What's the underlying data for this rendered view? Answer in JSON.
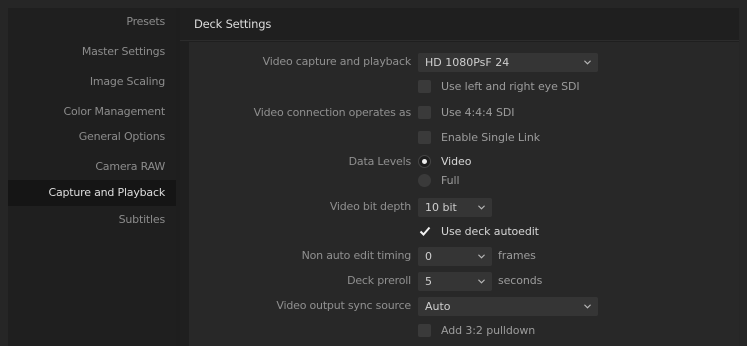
{
  "sidebar": {
    "items": [
      {
        "label": "Presets"
      },
      {
        "label": "Master Settings"
      },
      {
        "label": "Image Scaling"
      },
      {
        "label": "Color Management"
      },
      {
        "label": "General Options"
      },
      {
        "label": "Camera RAW"
      },
      {
        "label": "Capture and Playback",
        "active": true
      },
      {
        "label": "Subtitles"
      }
    ]
  },
  "section": {
    "title": "Deck Settings"
  },
  "form": {
    "video_capture": {
      "label": "Video capture and playback",
      "value": "HD 1080PsF 24"
    },
    "left_right_sdi": {
      "label": "Use left and right eye SDI",
      "checked": false
    },
    "video_connection": {
      "label": "Video connection operates as"
    },
    "use_444": {
      "label": "Use 4:4:4 SDI",
      "checked": false
    },
    "single_link": {
      "label": "Enable Single Link",
      "checked": false
    },
    "data_levels": {
      "label": "Data Levels",
      "options": [
        "Video",
        "Full"
      ],
      "selected": "Video"
    },
    "bit_depth": {
      "label": "Video bit depth",
      "value": "10 bit"
    },
    "deck_autoedit": {
      "label": "Use deck autoedit",
      "checked": true
    },
    "non_auto_edit": {
      "label": "Non auto edit timing",
      "value": "0",
      "unit": "frames"
    },
    "deck_preroll": {
      "label": "Deck preroll",
      "value": "5",
      "unit": "seconds"
    },
    "sync_source": {
      "label": "Video output sync source",
      "value": "Auto"
    },
    "pulldown": {
      "label": "Add 3:2 pulldown",
      "checked": false
    }
  },
  "colors": {
    "active_item_bg": "#151515",
    "panel_bg": "#282828",
    "control_bg": "#353535"
  }
}
